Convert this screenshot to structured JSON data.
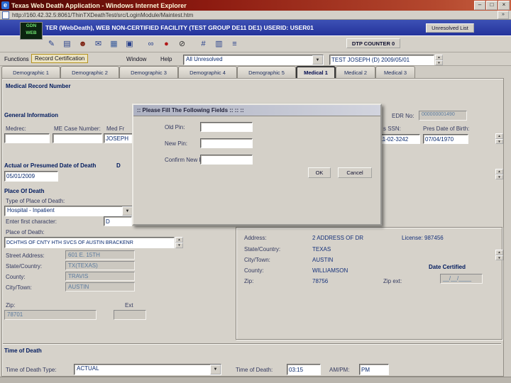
{
  "glyphs": {
    "up": "▲",
    "down": "▼",
    "min": "–",
    "max": "□",
    "close": "×",
    "ie": "e",
    "go": "»"
  },
  "colors": {
    "titlebar": "#8c1a10",
    "header_blue": "#24339b",
    "highlight_gold": "#b59320",
    "accent_navy": "#001a5e"
  },
  "window": {
    "title": "Texas Web Death Application - Windows Internet Explorer",
    "address": "http://160.42.32.5:8061/ThinTXDeathTest/src/LoginModule/Maintest.htm"
  },
  "header": {
    "logo_line1": "GDN",
    "logo_line2": "WEB",
    "title": "TER (WebDeath), WEB NON-CERTIFIED FACILITY (TEST GROUP DE11 DE1) USERID: USER01",
    "unresolved_button": "Unresolved List"
  },
  "toolbar": {
    "dtp_counter": "DTP COUNTER 0",
    "icons": [
      {
        "name": "compose-icon",
        "glyph": "✎"
      },
      {
        "name": "document-icon",
        "glyph": "▤"
      },
      {
        "name": "user-icon",
        "glyph": "☻"
      },
      {
        "name": "mail-icon",
        "glyph": "✉"
      },
      {
        "name": "save-icon",
        "glyph": "▦"
      },
      {
        "name": "print-icon",
        "glyph": "▣"
      },
      {
        "name": "binoculars-icon",
        "glyph": "∞"
      },
      {
        "name": "record-icon",
        "glyph": "●"
      },
      {
        "name": "stop-icon",
        "glyph": "⊘"
      },
      {
        "name": "calculator-icon",
        "glyph": "#"
      },
      {
        "name": "grid-icon",
        "glyph": "▥"
      },
      {
        "name": "list-icon",
        "glyph": "≡"
      }
    ]
  },
  "menu": {
    "functions": "Functions",
    "record_certification": "Record Certification",
    "window_item": "Window",
    "help": "Help",
    "filter_value": "All Unresolved",
    "record_value": "TEST JOSEPH (D) 2009/05/01"
  },
  "tabs": [
    {
      "label": "Demographic 1"
    },
    {
      "label": "Demographic 2"
    },
    {
      "label": "Demographic 3"
    },
    {
      "label": "Demographic 4"
    },
    {
      "label": "Demographic 5"
    },
    {
      "label": "Medical 1"
    },
    {
      "label": "Medical 2"
    },
    {
      "label": "Medical 3"
    }
  ],
  "dialog": {
    "title": ":: Please Fill The Following Fields :: :: ::",
    "old_pin_label": "Old Pin:",
    "new_pin_label": "New Pin:",
    "confirm_pin_label": "Confirm New Pin:",
    "ok_label": "OK",
    "cancel_label": "Cancel"
  },
  "content": {
    "mrn_label": "Medical Record Number",
    "general": {
      "title": "General Information",
      "medrec_label": "Medrec:",
      "me_case_label": "ME Case Number:",
      "med_fr_label": "Med Fr",
      "name_value": "JOSEPH",
      "edr_label": "EDR No:",
      "edr_value": "000000001490",
      "ssn_label": "s SSN:",
      "ssn_value": "111-02-3242",
      "dob_label": "Pres Date of Birth:",
      "dob_value": "07/04/1970"
    },
    "dod": {
      "title": "Actual or Presumed Date of Death",
      "partial_label": "D",
      "date_value": "05/01/2009"
    },
    "place": {
      "title": "Place Of Death",
      "type_label": "Type of Place of Death:",
      "type_value": "Hospital - Inpatient",
      "first_char_label": "Enter first character:",
      "first_char_value": "D",
      "pod_label": "Place of Death:",
      "pod_value": "DCHTHS OF CNTY HTH SVCS OF AUSTIN BRACKENR",
      "street_label": "Street Address:",
      "street_value": "601 E. 15TH",
      "state_label": "State/Country:",
      "state_value": "TX(TEXAS)",
      "county_label": "County:",
      "county_value": "TRAVIS",
      "city_label": "City/Town:",
      "city_value": "AUSTIN",
      "zip_label": "Zip:",
      "zip_value": "78701",
      "ext_label": "Ext"
    },
    "certifier": {
      "address_label": "Address:",
      "address_value": "2 ADDRESS OF DR",
      "license_text": "License: 987456",
      "state_label": "State/Country:",
      "state_value": "TEXAS",
      "city_label": "City/Town:",
      "city_value": "AUSTIN",
      "county_label": "County:",
      "county_value": "WILLIAMSON",
      "zip_label": "Zip:",
      "zip_value": "78756",
      "zip_ext_label": "Zip ext:",
      "date_certified_label": "Date Certified",
      "date_value": "__/__/____"
    },
    "tod": {
      "title": "Time of Death",
      "type_label": "Time of Death Type:",
      "type_value": "ACTUAL",
      "time_label": "Time of Death:",
      "time_value": "03:15",
      "ampm_label": "AM/PM:",
      "ampm_value": "PM"
    }
  }
}
